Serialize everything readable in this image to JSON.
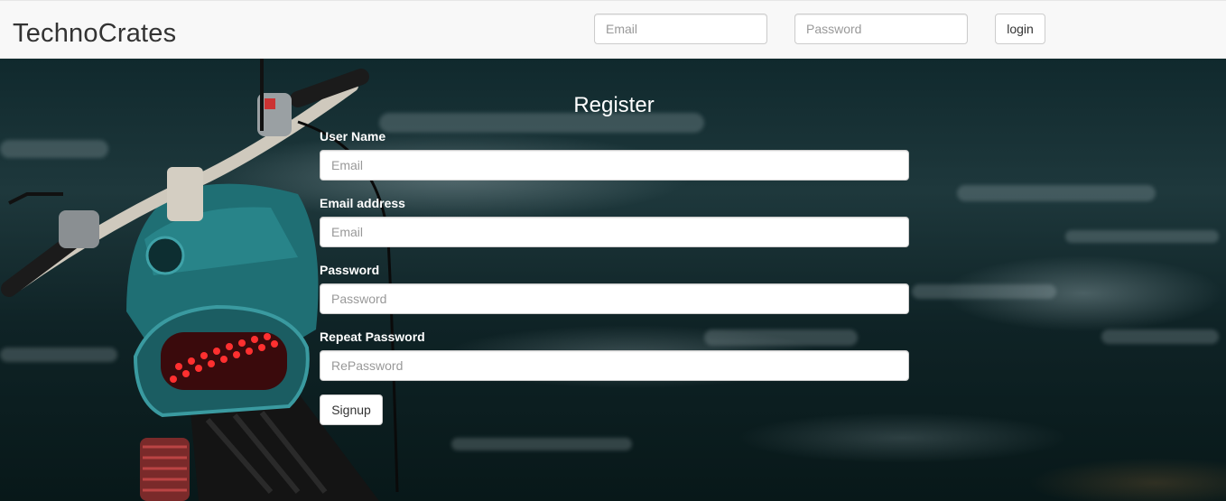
{
  "navbar": {
    "brand": "TechnoCrates",
    "email_placeholder": "Email",
    "password_placeholder": "Password",
    "login_label": "login"
  },
  "register": {
    "title": "Register",
    "username": {
      "label": "User Name",
      "placeholder": "Email"
    },
    "email": {
      "label": "Email address",
      "placeholder": "Email"
    },
    "password": {
      "label": "Password",
      "placeholder": "Password"
    },
    "repeat_password": {
      "label": "Repeat Password",
      "placeholder": "RePassword"
    },
    "signup_label": "Signup"
  },
  "colors": {
    "navbar_bg": "#f8f8f8",
    "form_text": "#ffffff",
    "taillight": "#e0202a",
    "bike_body": "#1f6f74"
  }
}
